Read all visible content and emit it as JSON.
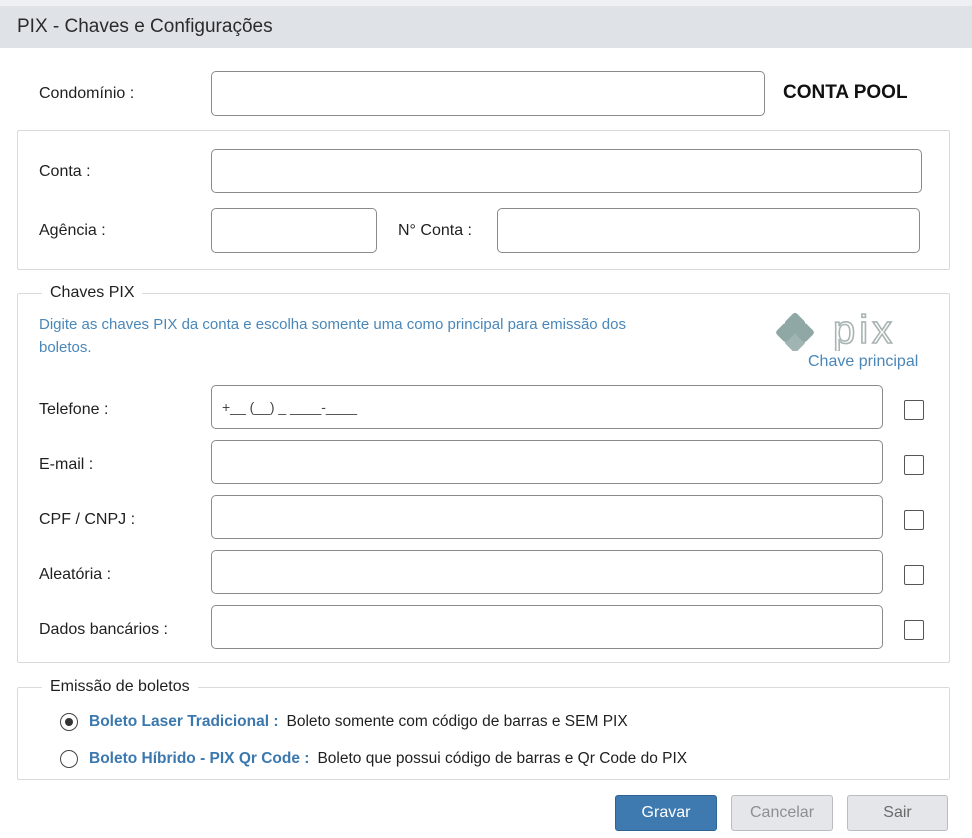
{
  "window": {
    "title": "PIX - Chaves e Configurações"
  },
  "condominio": {
    "label": "Condomínio :",
    "value": "",
    "badge": "CONTA POOL"
  },
  "bank": {
    "conta_label": "Conta :",
    "conta_value": "",
    "agencia_label": "Agência :",
    "agencia_value": "",
    "numero_label": "N° Conta :",
    "numero_value": ""
  },
  "chaves": {
    "legend": "Chaves PIX",
    "hint": "Digite as chaves PIX da conta e escolha somente uma como principal para emissão dos boletos.",
    "logo_text": "pix",
    "principal_caption": "Chave principal",
    "fields": [
      {
        "label": "Telefone :",
        "value": "",
        "placeholder": "+__ (__) _ ____-____",
        "principal": false
      },
      {
        "label": "E-mail :",
        "value": "",
        "placeholder": "",
        "principal": false
      },
      {
        "label": "CPF / CNPJ :",
        "value": "",
        "placeholder": "",
        "principal": false
      },
      {
        "label": "Aleatória :",
        "value": "",
        "placeholder": "",
        "principal": false
      },
      {
        "label": "Dados bancários :",
        "value": "",
        "placeholder": "",
        "principal": false
      }
    ]
  },
  "emissao": {
    "legend": "Emissão de boletos",
    "options": [
      {
        "title": "Boleto Laser Tradicional :",
        "desc": "Boleto somente com código de barras e SEM PIX",
        "selected": true
      },
      {
        "title": "Boleto Híbrido - PIX Qr Code :",
        "desc": "Boleto que possui código de barras e Qr Code do PIX",
        "selected": false
      }
    ]
  },
  "actions": {
    "save": "Gravar",
    "cancel": "Cancelar",
    "exit": "Sair"
  },
  "colors": {
    "accent": "#3e79b0",
    "hint_text": "#4a87b8",
    "pix_logo": "#8fa8a6",
    "titlebar": "#dfe3e8"
  }
}
